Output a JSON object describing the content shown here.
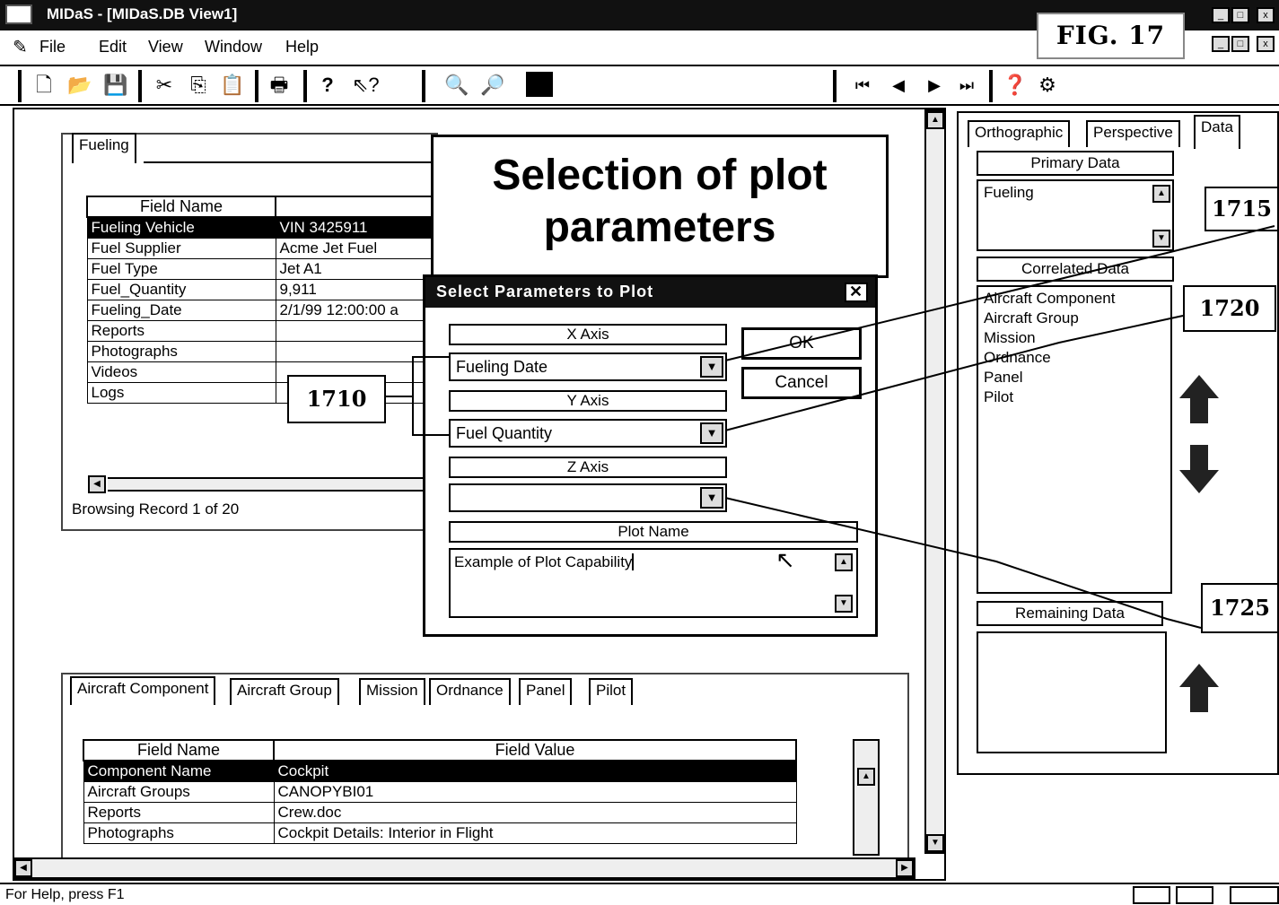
{
  "window": {
    "title": "MIDaS - [MIDaS.DB View1]",
    "figure_label": "FIG. 17"
  },
  "menu": {
    "file": "File",
    "edit": "Edit",
    "view": "View",
    "window": "Window",
    "help": "Help"
  },
  "fueling_panel": {
    "tab": "Fueling",
    "header_field": "Field Name",
    "rows": [
      {
        "name": "Fueling Vehicle",
        "value": "VIN 3425911"
      },
      {
        "name": "Fuel Supplier",
        "value": "Acme Jet Fuel"
      },
      {
        "name": "Fuel Type",
        "value": "Jet A1"
      },
      {
        "name": "Fuel_Quantity",
        "value": "9,911"
      },
      {
        "name": "Fueling_Date",
        "value": "2/1/99 12:00:00 a"
      },
      {
        "name": "Reports",
        "value": ""
      },
      {
        "name": "Photographs",
        "value": ""
      },
      {
        "name": "Videos",
        "value": ""
      },
      {
        "name": "Logs",
        "value": ""
      }
    ],
    "status": "Browsing Record 1 of 20"
  },
  "callout_big": {
    "line1": "Selection of plot",
    "line2": "parameters"
  },
  "callouts": {
    "c1710": "1710",
    "c1715": "1715",
    "c1720": "1720",
    "c1725": "1725"
  },
  "dialog": {
    "title": "Select Parameters to Plot",
    "x_axis_label": "X Axis",
    "x_axis_value": "Fueling Date",
    "y_axis_label": "Y Axis",
    "y_axis_value": "Fuel Quantity",
    "z_axis_label": "Z Axis",
    "z_axis_value": "",
    "plot_name_label": "Plot Name",
    "plot_name_value": "Example of Plot Capability",
    "ok": "OK",
    "cancel": "Cancel"
  },
  "lower_panel": {
    "tabs": [
      "Aircraft Component",
      "Aircraft Group",
      "Mission",
      "Ordnance",
      "Panel",
      "Pilot"
    ],
    "header_field": "Field Name",
    "header_value": "Field Value",
    "rows": [
      {
        "name": "Component Name",
        "value": "Cockpit"
      },
      {
        "name": "Aircraft Groups",
        "value": "CANOPYBI01"
      },
      {
        "name": "Reports",
        "value": "Crew.doc"
      },
      {
        "name": "Photographs",
        "value": "Cockpit Details: Interior in Flight"
      }
    ]
  },
  "right_panel": {
    "tabs": [
      "Orthographic",
      "Perspective",
      "Data"
    ],
    "primary_label": "Primary Data",
    "primary_items": [
      "Fueling"
    ],
    "correlated_label": "Correlated Data",
    "correlated_items": [
      "Aircraft Component",
      "Aircraft Group",
      "Mission",
      "Ordnance",
      "Panel",
      "Pilot"
    ],
    "remaining_label": "Remaining Data"
  },
  "statusbar": {
    "text": "For Help, press F1"
  }
}
